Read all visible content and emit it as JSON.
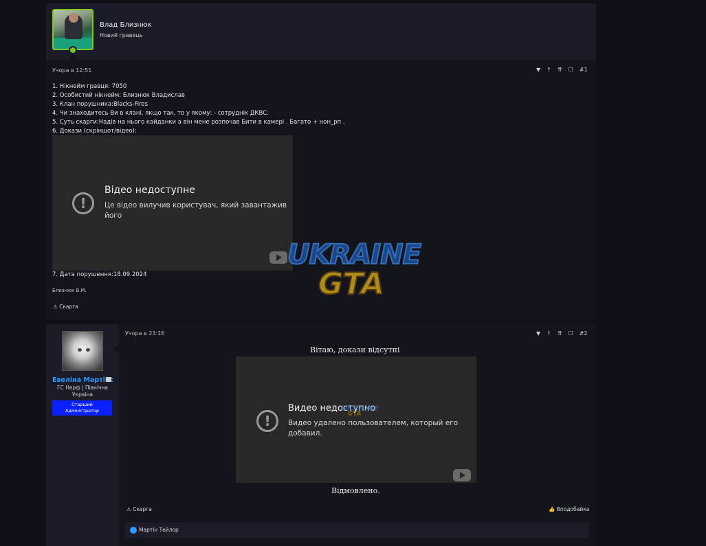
{
  "post1": {
    "username": "Влад Близнюк",
    "user_role": "Новий гравець",
    "timestamp": "Учора в 12:51",
    "post_number": "#1",
    "lines": [
      "1. Нікнейм гравця: 7050",
      "2. Особистий нікнейм: Близнюк Владислав",
      "3. Клан порушника:Blacks-Fires",
      "4. Чи знаходитесь Ви в клані, якщо так, то у якому: - сотруднік ДКВС.",
      "5. Суть скарги:Надів на нього кайданки а він мене розпочав Бити в камері . Багато + нон_рп .",
      "6. Докази (скріншот/відео):"
    ],
    "video": {
      "title": "Відео недоступне",
      "subtitle_line1": "Це відео вилучив користувач, який завантажив",
      "subtitle_line2": "його"
    },
    "date_line": "7. Дата порушення:18.09.2024",
    "signature": "Близнюк В.М.",
    "report_label": "Скарга"
  },
  "post2": {
    "username": "Евеліна Мартінс",
    "user_title_line1": "ГС Нерф | Північна",
    "user_title_line2": "Україна",
    "role_line1": "Старший",
    "role_line2": "Адміністратор",
    "timestamp": "Учора в 23:16",
    "post_number": "#2",
    "greeting": "Вітаю, докази відсутні",
    "video": {
      "title": "Видео недоступно",
      "subtitle_line1": "Видео удалено пользователем, который его",
      "subtitle_line2": "добавил."
    },
    "verdict": "Відмовлено.",
    "report_label": "Скарга",
    "like_label": "Вподобайка",
    "reaction_user": "Мартін Тейлор"
  },
  "watermark": {
    "top": "UKRAINE",
    "bottom": "GTA"
  }
}
